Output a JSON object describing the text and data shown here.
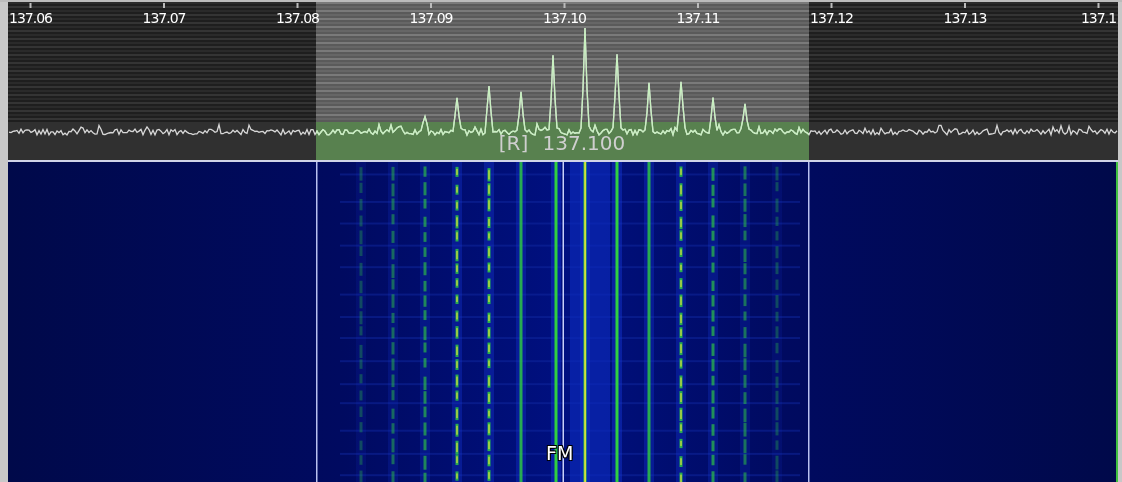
{
  "frequency_axis": {
    "ticks": [
      "137.06",
      "137.07",
      "137.08",
      "137.09",
      "137.10",
      "137.11",
      "137.12",
      "137.13",
      "137.1"
    ]
  },
  "filter": {
    "label": "[R] 137.100"
  },
  "waterfall": {
    "mode_label": "FM"
  }
}
